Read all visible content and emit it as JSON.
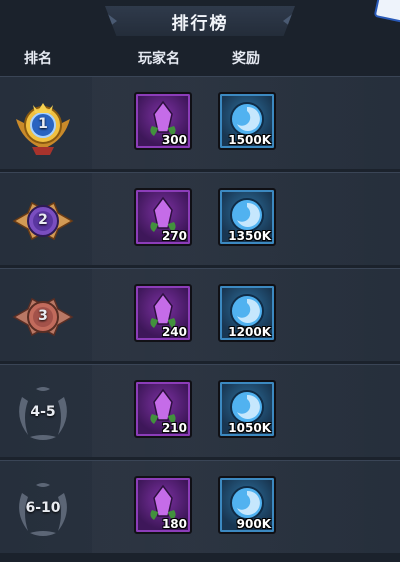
{
  "title": "排行榜",
  "headers": {
    "rank": "排名",
    "player": "玩家名",
    "reward": "奖励"
  },
  "rows": [
    {
      "rank": "1",
      "items": [
        {
          "icon": "purple-crystal-icon",
          "qty": "300"
        },
        {
          "icon": "blue-orb-icon",
          "qty": "1500K"
        }
      ]
    },
    {
      "rank": "2",
      "items": [
        {
          "icon": "purple-crystal-icon",
          "qty": "270"
        },
        {
          "icon": "blue-orb-icon",
          "qty": "1350K"
        }
      ]
    },
    {
      "rank": "3",
      "items": [
        {
          "icon": "purple-crystal-icon",
          "qty": "240"
        },
        {
          "icon": "blue-orb-icon",
          "qty": "1200K"
        }
      ]
    },
    {
      "rank": "4-5",
      "items": [
        {
          "icon": "purple-crystal-icon",
          "qty": "210"
        },
        {
          "icon": "blue-orb-icon",
          "qty": "1050K"
        }
      ]
    },
    {
      "rank": "6-10",
      "items": [
        {
          "icon": "purple-crystal-icon",
          "qty": "180"
        },
        {
          "icon": "blue-orb-icon",
          "qty": "900K"
        }
      ]
    }
  ],
  "colors": {
    "gold": "#f0c040",
    "silver": "#c07fd8",
    "bronze": "#d98a7a",
    "laurel": "#6c7686",
    "purple_item": "#7a2ea0",
    "blue_item": "#2c6f9e"
  }
}
